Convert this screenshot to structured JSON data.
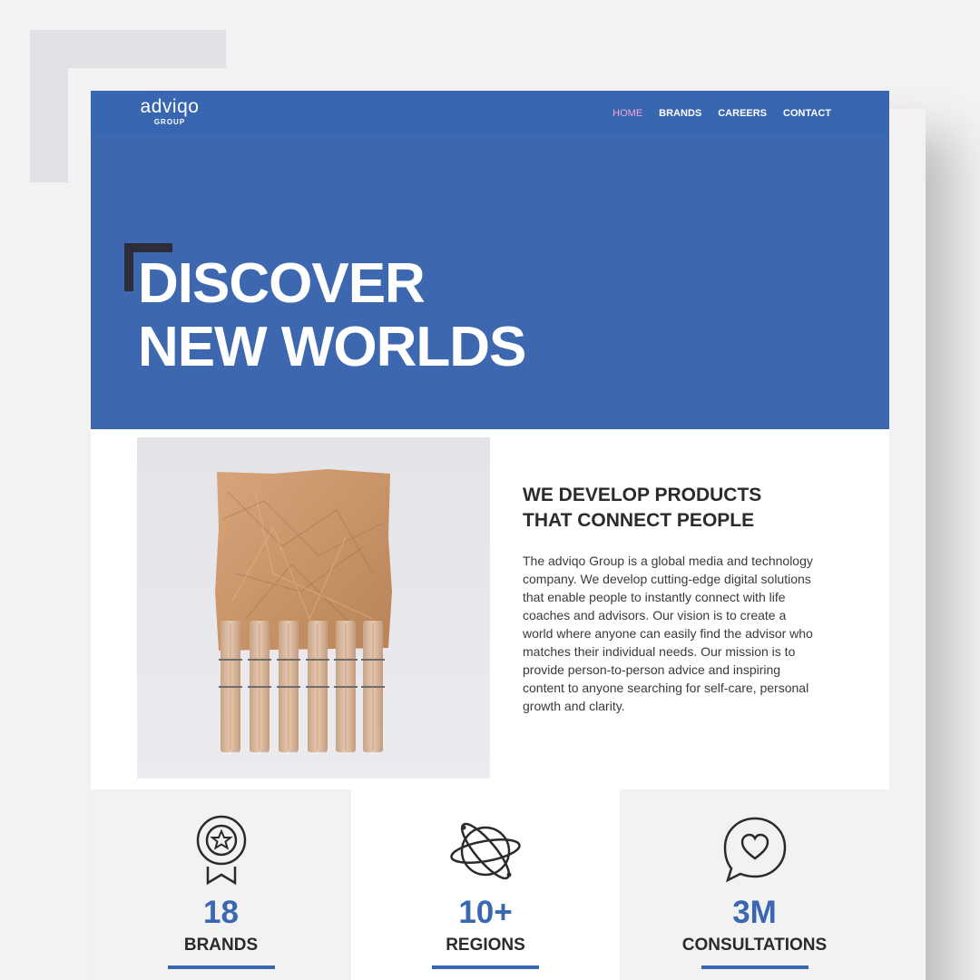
{
  "brand": {
    "name": "adviqo",
    "subline": "GROUP"
  },
  "nav": [
    {
      "label": "HOME",
      "active": true
    },
    {
      "label": "BRANDS",
      "active": false
    },
    {
      "label": "CAREERS",
      "active": false
    },
    {
      "label": "CONTACT",
      "active": false
    }
  ],
  "hero": {
    "line1": "DISCOVER",
    "line2": "NEW WORLDS"
  },
  "intro": {
    "heading_line1": "WE DEVELOP PRODUCTS",
    "heading_line2": "THAT CONNECT PEOPLE",
    "body": "The adviqo Group is a global media and technology company. We develop cutting-edge digital solutions that enable people to instantly connect with life coaches and advisors. Our vision is to create a world where anyone can easily find the advisor who matches their individual needs. Our mission is to provide person-to-person advice and inspiring content to anyone searching for self-care, personal growth and clarity."
  },
  "stats": [
    {
      "value": "18",
      "label": "BRANDS",
      "icon": "award-ribbon-icon",
      "caption": ""
    },
    {
      "value": "10+",
      "label": "REGIONS",
      "icon": "globe-orbit-icon",
      "caption": ""
    },
    {
      "value": "3M",
      "label": "CONSULTATIONS",
      "icon": "heart-chat-icon",
      "caption": ""
    }
  ],
  "colors": {
    "primary": "#3d68b0",
    "accent": "#f5a6d6",
    "dark": "#2b2b2b"
  }
}
